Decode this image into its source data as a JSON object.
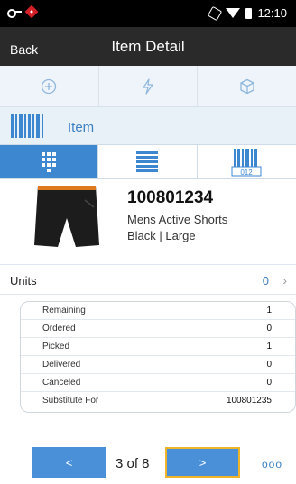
{
  "status_bar": {
    "time": "12:10",
    "icons": [
      "key-icon",
      "alert-icon",
      "rotation-lock-icon",
      "wifi-icon",
      "battery-icon"
    ]
  },
  "header": {
    "back_label": "Back",
    "title": "Item Detail"
  },
  "actions": [
    {
      "icon": "add-circle-icon"
    },
    {
      "icon": "lightning-icon"
    },
    {
      "icon": "package-icon"
    }
  ],
  "item_header": {
    "icon": "barcode-icon",
    "label": "Item"
  },
  "view_tabs": [
    {
      "icon": "grid-view-icon",
      "active": true
    },
    {
      "icon": "list-view-icon",
      "active": false
    },
    {
      "icon": "barcode-view-icon",
      "label": "012",
      "active": false
    }
  ],
  "item": {
    "number": "100801234",
    "description": "Mens Active Shorts",
    "variant": "Black | Large",
    "image_icon": "shorts-image"
  },
  "units": {
    "label": "Units",
    "value": "0"
  },
  "details": [
    {
      "key": "Remaining",
      "value": "1"
    },
    {
      "key": "Ordered",
      "value": "0"
    },
    {
      "key": "Picked",
      "value": "1"
    },
    {
      "key": "Delivered",
      "value": "0"
    },
    {
      "key": "Canceled",
      "value": "0"
    },
    {
      "key": "Substitute For",
      "value": "100801235"
    }
  ],
  "pager": {
    "prev_label": "<",
    "page_text": "3 of 8",
    "next_label": ">",
    "more_label": "ooo"
  },
  "colors": {
    "accent": "#4a90d9",
    "header_bg": "#2a2a2a",
    "link": "#3c7fc0",
    "focus": "#f0b429"
  }
}
